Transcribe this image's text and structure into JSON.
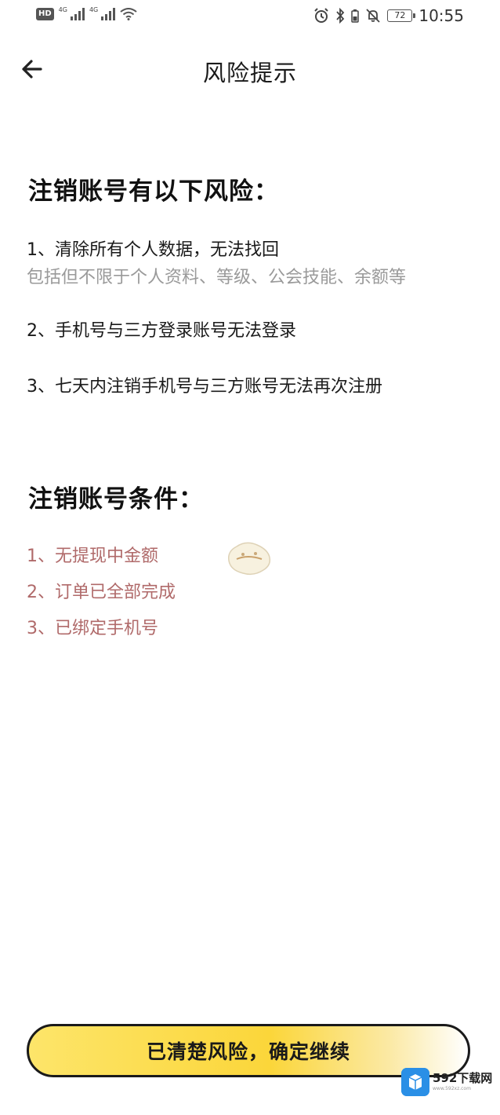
{
  "status_bar": {
    "hd_label": "HD",
    "signal1_label": "4G",
    "signal2_label": "4G",
    "battery_level": "72",
    "time": "10:55",
    "icons": [
      "alarm-icon",
      "bluetooth-icon",
      "battery-saver-icon",
      "mute-icon",
      "wifi-icon"
    ]
  },
  "header": {
    "title": "风险提示",
    "back_icon": "back-arrow-icon"
  },
  "risks": {
    "title": "注销账号有以下风险：",
    "items": [
      {
        "text": "1、清除所有个人数据，无法找回",
        "sub": "包括但不限于个人资料、等级、公会技能、余额等"
      },
      {
        "text": "2、手机号与三方登录账号无法登录"
      },
      {
        "text": "3、七天内注销手机号与三方账号无法再次注册"
      }
    ]
  },
  "conditions": {
    "title": "注销账号条件：",
    "items": [
      "1、无提现中金额",
      "2、订单已全部完成",
      "3、已绑定手机号"
    ]
  },
  "footer": {
    "confirm_label": "已清楚风险，确定继续"
  },
  "watermark": {
    "main": "592下载网",
    "sub": "www.592xz.com"
  },
  "colors": {
    "button_yellow": "#fbd63a",
    "condition_text": "#b06a6a",
    "sub_text": "#9a9a9a",
    "watermark_blue": "#2a8fe6"
  }
}
